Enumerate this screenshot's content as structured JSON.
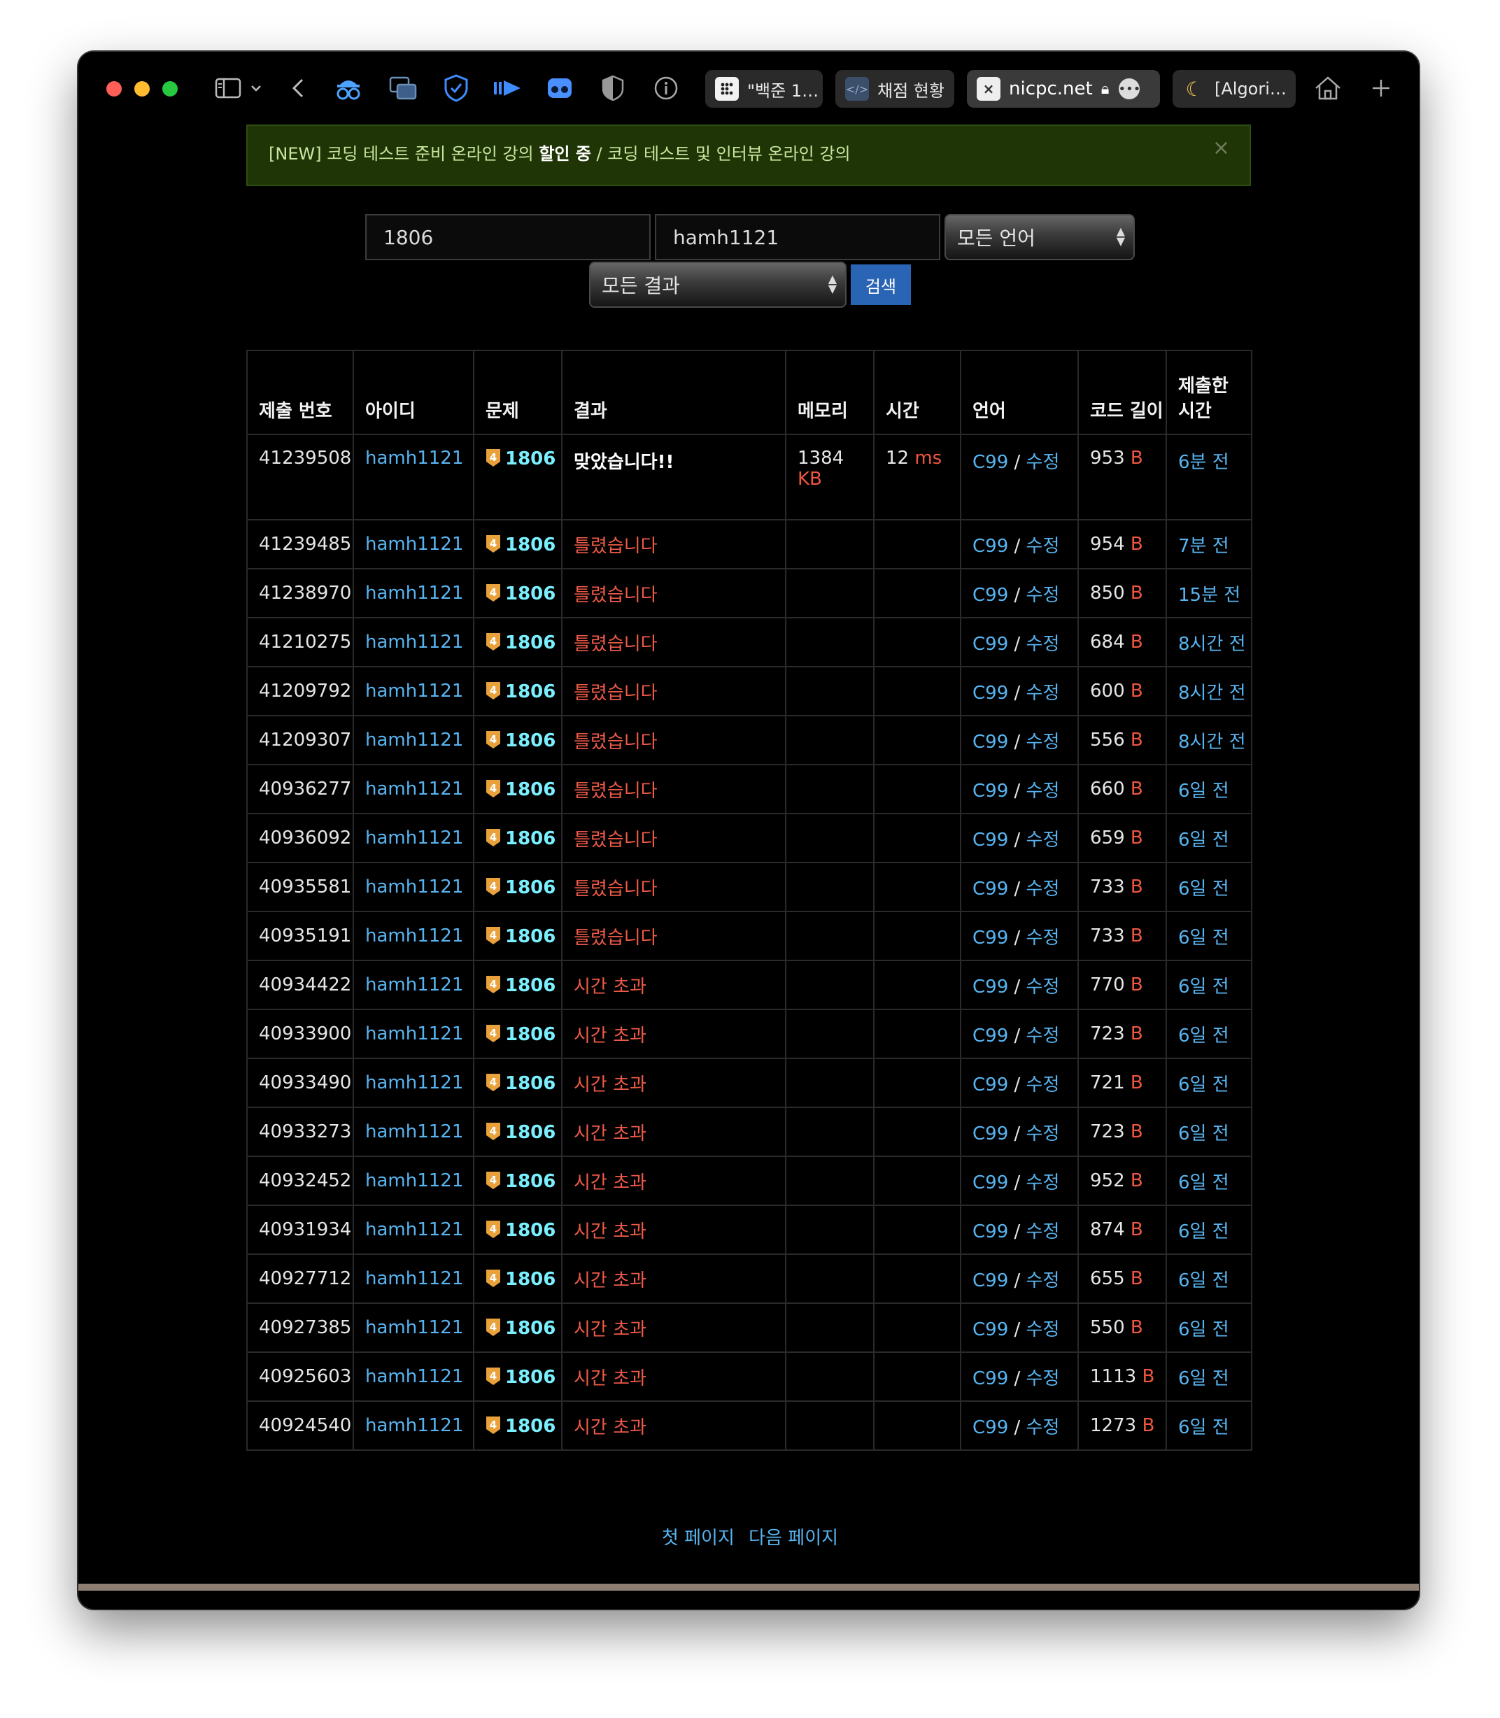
{
  "browser": {
    "tabs": [
      {
        "label": "\"백준 1…"
      },
      {
        "label": "채점 현황"
      },
      {
        "label": "nicpc.net"
      },
      {
        "label": "[Algori…"
      }
    ]
  },
  "notice": {
    "prefix": "[NEW] 코딩 테스트 준비 온라인 강의 ",
    "highlight": "할인 중",
    "suffix": " / 코딩 테스트 및 인터뷰 온라인 강의",
    "close": "×"
  },
  "search": {
    "problem_id": "1806",
    "user_id": "hamh1121",
    "language_select": "모든 언어",
    "result_select": "모든 결과",
    "search_button": "검색"
  },
  "table": {
    "headers": [
      "제출 번호",
      "아이디",
      "문제",
      "결과",
      "메모리",
      "시간",
      "언어",
      "코드 길이",
      "제출한 시간"
    ],
    "rows": [
      {
        "id": "41239508",
        "user": "hamh1121",
        "problem": "1806",
        "result": "맞았습니다!!",
        "memory": "1384",
        "memory_unit": "KB",
        "time": "12",
        "time_unit": "ms",
        "lang": "C99",
        "edit": "수정",
        "length": "953",
        "length_unit": "B",
        "when": "6분 전"
      },
      {
        "id": "41239485",
        "user": "hamh1121",
        "problem": "1806",
        "result": "틀렸습니다",
        "memory": "",
        "memory_unit": "",
        "time": "",
        "time_unit": "",
        "lang": "C99",
        "edit": "수정",
        "length": "954",
        "length_unit": "B",
        "when": "7분 전"
      },
      {
        "id": "41238970",
        "user": "hamh1121",
        "problem": "1806",
        "result": "틀렸습니다",
        "memory": "",
        "memory_unit": "",
        "time": "",
        "time_unit": "",
        "lang": "C99",
        "edit": "수정",
        "length": "850",
        "length_unit": "B",
        "when": "15분 전"
      },
      {
        "id": "41210275",
        "user": "hamh1121",
        "problem": "1806",
        "result": "틀렸습니다",
        "memory": "",
        "memory_unit": "",
        "time": "",
        "time_unit": "",
        "lang": "C99",
        "edit": "수정",
        "length": "684",
        "length_unit": "B",
        "when": "8시간 전"
      },
      {
        "id": "41209792",
        "user": "hamh1121",
        "problem": "1806",
        "result": "틀렸습니다",
        "memory": "",
        "memory_unit": "",
        "time": "",
        "time_unit": "",
        "lang": "C99",
        "edit": "수정",
        "length": "600",
        "length_unit": "B",
        "when": "8시간 전"
      },
      {
        "id": "41209307",
        "user": "hamh1121",
        "problem": "1806",
        "result": "틀렸습니다",
        "memory": "",
        "memory_unit": "",
        "time": "",
        "time_unit": "",
        "lang": "C99",
        "edit": "수정",
        "length": "556",
        "length_unit": "B",
        "when": "8시간 전"
      },
      {
        "id": "40936277",
        "user": "hamh1121",
        "problem": "1806",
        "result": "틀렸습니다",
        "memory": "",
        "memory_unit": "",
        "time": "",
        "time_unit": "",
        "lang": "C99",
        "edit": "수정",
        "length": "660",
        "length_unit": "B",
        "when": "6일 전"
      },
      {
        "id": "40936092",
        "user": "hamh1121",
        "problem": "1806",
        "result": "틀렸습니다",
        "memory": "",
        "memory_unit": "",
        "time": "",
        "time_unit": "",
        "lang": "C99",
        "edit": "수정",
        "length": "659",
        "length_unit": "B",
        "when": "6일 전"
      },
      {
        "id": "40935581",
        "user": "hamh1121",
        "problem": "1806",
        "result": "틀렸습니다",
        "memory": "",
        "memory_unit": "",
        "time": "",
        "time_unit": "",
        "lang": "C99",
        "edit": "수정",
        "length": "733",
        "length_unit": "B",
        "when": "6일 전"
      },
      {
        "id": "40935191",
        "user": "hamh1121",
        "problem": "1806",
        "result": "틀렸습니다",
        "memory": "",
        "memory_unit": "",
        "time": "",
        "time_unit": "",
        "lang": "C99",
        "edit": "수정",
        "length": "733",
        "length_unit": "B",
        "when": "6일 전"
      },
      {
        "id": "40934422",
        "user": "hamh1121",
        "problem": "1806",
        "result": "시간 초과",
        "memory": "",
        "memory_unit": "",
        "time": "",
        "time_unit": "",
        "lang": "C99",
        "edit": "수정",
        "length": "770",
        "length_unit": "B",
        "when": "6일 전"
      },
      {
        "id": "40933900",
        "user": "hamh1121",
        "problem": "1806",
        "result": "시간 초과",
        "memory": "",
        "memory_unit": "",
        "time": "",
        "time_unit": "",
        "lang": "C99",
        "edit": "수정",
        "length": "723",
        "length_unit": "B",
        "when": "6일 전"
      },
      {
        "id": "40933490",
        "user": "hamh1121",
        "problem": "1806",
        "result": "시간 초과",
        "memory": "",
        "memory_unit": "",
        "time": "",
        "time_unit": "",
        "lang": "C99",
        "edit": "수정",
        "length": "721",
        "length_unit": "B",
        "when": "6일 전"
      },
      {
        "id": "40933273",
        "user": "hamh1121",
        "problem": "1806",
        "result": "시간 초과",
        "memory": "",
        "memory_unit": "",
        "time": "",
        "time_unit": "",
        "lang": "C99",
        "edit": "수정",
        "length": "723",
        "length_unit": "B",
        "when": "6일 전"
      },
      {
        "id": "40932452",
        "user": "hamh1121",
        "problem": "1806",
        "result": "시간 초과",
        "memory": "",
        "memory_unit": "",
        "time": "",
        "time_unit": "",
        "lang": "C99",
        "edit": "수정",
        "length": "952",
        "length_unit": "B",
        "when": "6일 전"
      },
      {
        "id": "40931934",
        "user": "hamh1121",
        "problem": "1806",
        "result": "시간 초과",
        "memory": "",
        "memory_unit": "",
        "time": "",
        "time_unit": "",
        "lang": "C99",
        "edit": "수정",
        "length": "874",
        "length_unit": "B",
        "when": "6일 전"
      },
      {
        "id": "40927712",
        "user": "hamh1121",
        "problem": "1806",
        "result": "시간 초과",
        "memory": "",
        "memory_unit": "",
        "time": "",
        "time_unit": "",
        "lang": "C99",
        "edit": "수정",
        "length": "655",
        "length_unit": "B",
        "when": "6일 전"
      },
      {
        "id": "40927385",
        "user": "hamh1121",
        "problem": "1806",
        "result": "시간 초과",
        "memory": "",
        "memory_unit": "",
        "time": "",
        "time_unit": "",
        "lang": "C99",
        "edit": "수정",
        "length": "550",
        "length_unit": "B",
        "when": "6일 전"
      },
      {
        "id": "40925603",
        "user": "hamh1121",
        "problem": "1806",
        "result": "시간 초과",
        "memory": "",
        "memory_unit": "",
        "time": "",
        "time_unit": "",
        "lang": "C99",
        "edit": "수정",
        "length": "1113",
        "length_unit": "B",
        "when": "6일 전"
      },
      {
        "id": "40924540",
        "user": "hamh1121",
        "problem": "1806",
        "result": "시간 초과",
        "memory": "",
        "memory_unit": "",
        "time": "",
        "time_unit": "",
        "lang": "C99",
        "edit": "수정",
        "length": "1273",
        "length_unit": "B",
        "when": "6일 전"
      }
    ]
  },
  "pagination": {
    "first": "첫 페이지",
    "next": "다음 페이지"
  },
  "colors": {
    "link": "#58b4f0",
    "unit": "#ef5640",
    "wrong": "#ef5a48",
    "problem": "#7af0ff",
    "notice_bg": "#1f3505",
    "search_button": "#2a64b4"
  },
  "icons": [
    "sidebar-icon",
    "chevron-down-icon",
    "back-icon",
    "spy-glasses-icon",
    "windows-icon",
    "shield-check-icon",
    "arrow-play-icon",
    "controller-icon",
    "half-shield-icon",
    "info-icon",
    "home-icon",
    "plus-icon",
    "tier-gold-icon"
  ]
}
